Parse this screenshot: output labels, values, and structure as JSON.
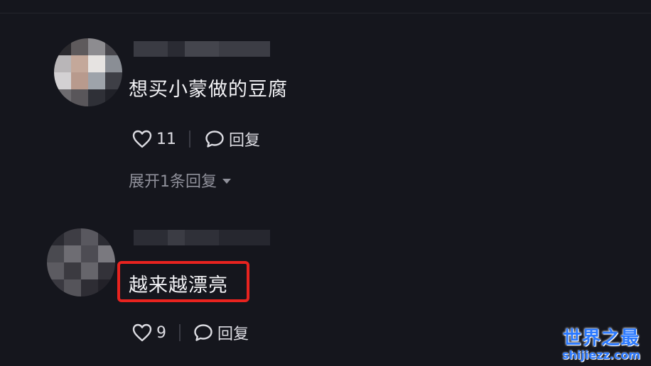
{
  "comments": [
    {
      "text": "想买小蒙做的豆腐",
      "likes": "11",
      "reply_label": "回复",
      "expand_label": "展开1条回复"
    },
    {
      "text": "越来越漂亮",
      "likes": "9",
      "reply_label": "回复"
    }
  ],
  "watermark": {
    "title": "世界之最",
    "url": "shijiezz.com"
  },
  "colors": {
    "background": "#15161d",
    "highlight_border": "#e8231f",
    "watermark": "#2b79ff"
  },
  "icons": {
    "like": "heart-icon",
    "reply": "speech-bubble-icon",
    "expand": "caret-down-icon"
  }
}
